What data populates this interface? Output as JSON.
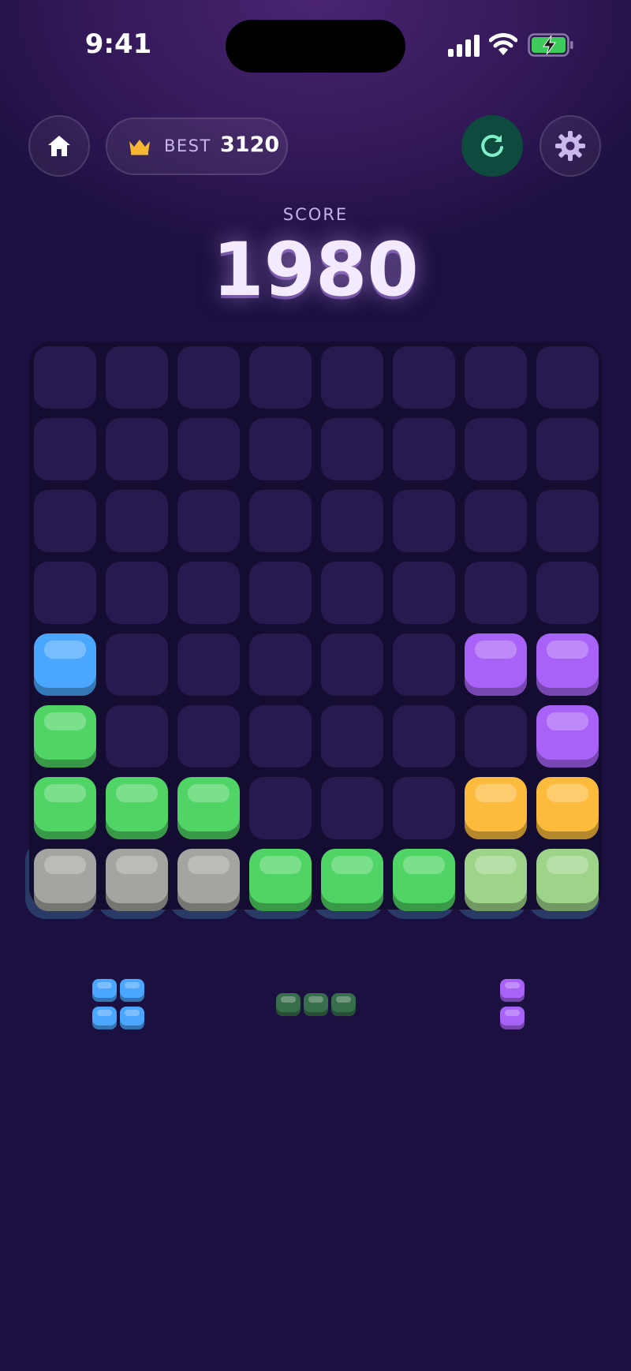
{
  "status_bar": {
    "time": "9:41",
    "icons": [
      "signal-icon",
      "wifi-icon",
      "battery-charging-icon"
    ]
  },
  "header": {
    "home_icon": "home-icon",
    "best": {
      "icon": "crown-icon",
      "label": "BEST",
      "value": "3120"
    },
    "restart_icon": "restart-icon",
    "settings_icon": "gear-icon"
  },
  "score": {
    "label": "SCORE",
    "value": "1980"
  },
  "colors": {
    "blue": "#4aa6ff",
    "green": "#4fd465",
    "purple": "#a862f7",
    "orange": "#fdbb3d",
    "gray": "#a4a4a0",
    "light_green": "#9ed48a",
    "dark_green": "#386e4c",
    "empty": "#271a4e",
    "board": "#140c31"
  },
  "board": {
    "columns": 8,
    "rows": 8,
    "cells": [
      [
        "",
        "",
        "",
        "",
        "",
        "",
        "",
        ""
      ],
      [
        "",
        "",
        "",
        "",
        "",
        "",
        "",
        ""
      ],
      [
        "",
        "",
        "",
        "",
        "",
        "",
        "",
        ""
      ],
      [
        "",
        "",
        "",
        "",
        "",
        "",
        "",
        ""
      ],
      [
        "blue",
        "",
        "",
        "",
        "",
        "",
        "purple",
        "purple"
      ],
      [
        "green",
        "",
        "",
        "",
        "",
        "",
        "",
        "purple"
      ],
      [
        "green",
        "green",
        "green",
        "",
        "",
        "",
        "orange",
        "orange"
      ],
      [
        "gray",
        "gray",
        "gray",
        "green",
        "green",
        "green",
        "light_green",
        "light_green"
      ]
    ],
    "highlighted_row": 7
  },
  "tray": {
    "pieces": [
      {
        "color": "blue",
        "shape": [
          [
            1,
            1
          ],
          [
            1,
            1
          ]
        ]
      },
      {
        "color": "dark_green",
        "shape": [
          [
            1,
            1,
            1
          ]
        ]
      },
      {
        "color": "purple",
        "shape": [
          [
            1
          ],
          [
            1
          ]
        ]
      }
    ]
  }
}
